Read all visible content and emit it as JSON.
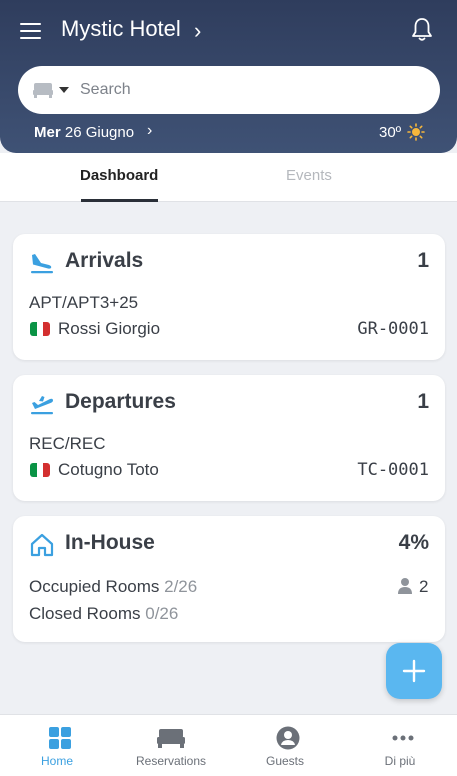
{
  "header": {
    "hotel_name": "Mystic Hotel",
    "search_placeholder": "Search",
    "date_day": "Mer",
    "date_rest": "26 Giugno",
    "temperature": "30º"
  },
  "tabs": [
    {
      "label": "Dashboard",
      "active": true
    },
    {
      "label": "Events",
      "active": false
    }
  ],
  "arrivals": {
    "title": "Arrivals",
    "count": "1",
    "room": "APT/APT3+25",
    "guest": "Rossi Giorgio",
    "code": "GR-0001"
  },
  "departures": {
    "title": "Departures",
    "count": "1",
    "room": "REC/REC",
    "guest": "Cotugno Toto",
    "code": "TC-0001"
  },
  "inhouse": {
    "title": "In-House",
    "percent": "4%",
    "occupied_label": "Occupied Rooms",
    "occupied_value": "2/26",
    "closed_label": "Closed Rooms",
    "closed_value": "0/26",
    "guests_count": "2"
  },
  "bottom_nav": [
    {
      "label": "Home",
      "icon": "grid-icon",
      "active": true
    },
    {
      "label": "Reservations",
      "icon": "bed-icon",
      "active": false
    },
    {
      "label": "Guests",
      "icon": "user-circle-icon",
      "active": false
    },
    {
      "label": "Di più",
      "icon": "more-icon",
      "active": false
    }
  ],
  "colors": {
    "header": "#3f5275",
    "accent": "#3ba0e0",
    "fab": "#5ab7f0"
  }
}
